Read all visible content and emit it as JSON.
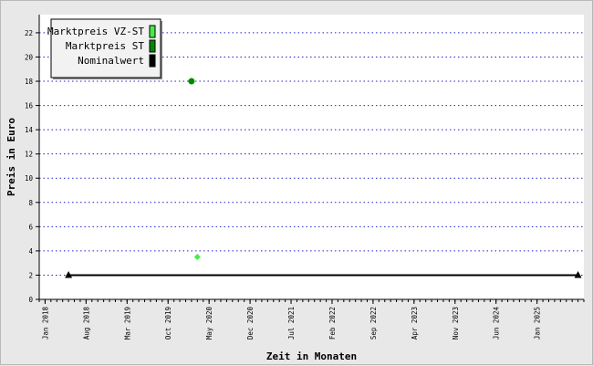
{
  "chart_data": {
    "type": "scatter",
    "xlabel": "Zeit in Monaten",
    "ylabel": "Preis in Euro",
    "ylim": [
      0,
      23.5
    ],
    "yticks": [
      0,
      2,
      4,
      6,
      8,
      10,
      12,
      14,
      16,
      18,
      20,
      22
    ],
    "xlim": [
      "2017-12",
      "2025-09"
    ],
    "xticks": [
      "Jan 2018",
      "Aug 2018",
      "Mar 2019",
      "Oct 2019",
      "May 2020",
      "Dec 2020",
      "Jul 2021",
      "Feb 2022",
      "Sep 2022",
      "Apr 2023",
      "Nov 2023",
      "Jun 2024",
      "Jan 2025"
    ],
    "grid": true,
    "legend_position": "top-left",
    "series": [
      {
        "name": "Marktpreis VZ-ST",
        "color": "#44ee44",
        "marker": "diamond",
        "points": [
          {
            "x": "2020-03",
            "y": 3.5
          }
        ]
      },
      {
        "name": "Marktpreis ST",
        "color": "#008800",
        "marker": "circle",
        "points": [
          {
            "x": "2020-02",
            "y": 18
          }
        ]
      },
      {
        "name": "Nominalwert",
        "color": "#000000",
        "marker": "triangle",
        "line": true,
        "points": [
          {
            "x": "2018-05",
            "y": 2
          },
          {
            "x": "2025-08",
            "y": 2
          }
        ]
      }
    ]
  }
}
